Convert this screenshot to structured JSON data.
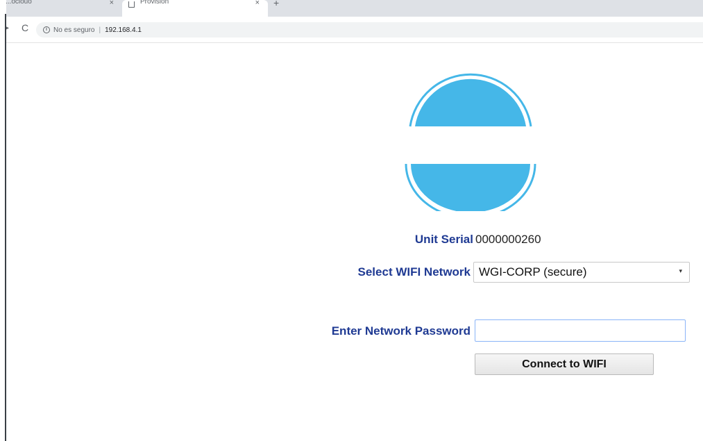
{
  "browser": {
    "tabs": [
      {
        "label": "...ociouo",
        "close": "×"
      },
      {
        "label": "Provision",
        "close": "×"
      }
    ],
    "new_tab": "+",
    "back": "▸",
    "reload": "C",
    "info_icon": "i",
    "security_label": "No es seguro",
    "url_separator": "|",
    "url": "192.168.4.1"
  },
  "page": {
    "logo_color": "#45b7e8",
    "serial_label": "Unit Serial",
    "serial_value": "0000000260",
    "wifi_label": "Select WIFI Network",
    "wifi_selected": "WGI-CORP (secure)",
    "select_arrow": "▾",
    "password_label": "Enter Network Password",
    "password_value": "",
    "connect_label": "Connect to WIFI"
  }
}
